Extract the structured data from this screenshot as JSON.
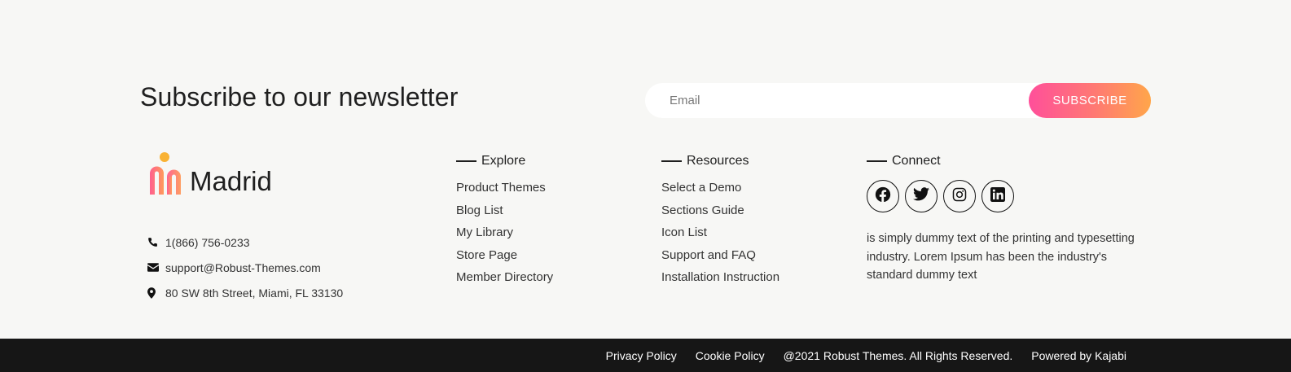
{
  "newsletter": {
    "title": "Subscribe to our newsletter",
    "email_placeholder": "Email",
    "subscribe_label": "SUBSCRIBE"
  },
  "brand": {
    "name": "Madrid",
    "accent_gradient": [
      "#ff4f9a",
      "#ff7a72",
      "#ffa64a"
    ],
    "dot_color": "#f9b233"
  },
  "contact": {
    "phone": "1(866) 756-0233",
    "email": "support@Robust-Themes.com",
    "address": "80 SW 8th Street, Miami, FL 33130",
    "icons": [
      "phone-icon",
      "envelope-icon",
      "map-pin-icon"
    ]
  },
  "explore": {
    "heading": "Explore",
    "links": [
      "Product Themes",
      "Blog List",
      "My Library",
      "Store Page",
      "Member Directory"
    ]
  },
  "resources": {
    "heading": "Resources",
    "links": [
      "Select a Demo",
      "Sections Guide",
      "Icon List",
      "Support and FAQ",
      "Installation Instruction"
    ]
  },
  "connect": {
    "heading": "Connect",
    "social": [
      "facebook-icon",
      "twitter-icon",
      "instagram-icon",
      "linkedin-icon"
    ],
    "text": "is simply dummy text of the printing and typesetting industry. Lorem Ipsum has been the industry's standard dummy text"
  },
  "footer_bar": {
    "privacy": "Privacy Policy",
    "cookie": "Cookie Policy",
    "copyright": "@2021 Robust Themes. All Rights Reserved.",
    "powered": "Powered by Kajabi",
    "background": "#161616"
  }
}
